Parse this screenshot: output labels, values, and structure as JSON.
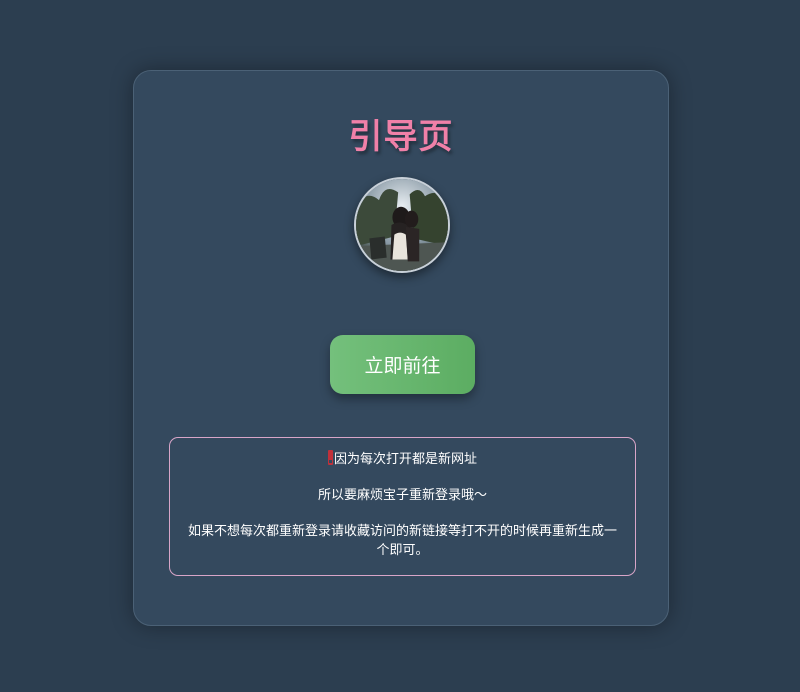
{
  "page": {
    "title": "引导页",
    "avatar_icon": "avatar-photo"
  },
  "action": {
    "go_label": "立即前往"
  },
  "notice": {
    "warning_icon": "exclamation-icon",
    "line1": "因为每次打开都是新网址",
    "line2": "所以要麻烦宝子重新登录哦～",
    "line3": "如果不想每次都重新登录请收藏访问的新链接等打不开的时候再重新生成一个即可。"
  },
  "colors": {
    "background": "#2c3e50",
    "card": "#34495e",
    "title": "#f080a8",
    "button": "#66b56d",
    "notice_border": "#d8a5c8"
  }
}
